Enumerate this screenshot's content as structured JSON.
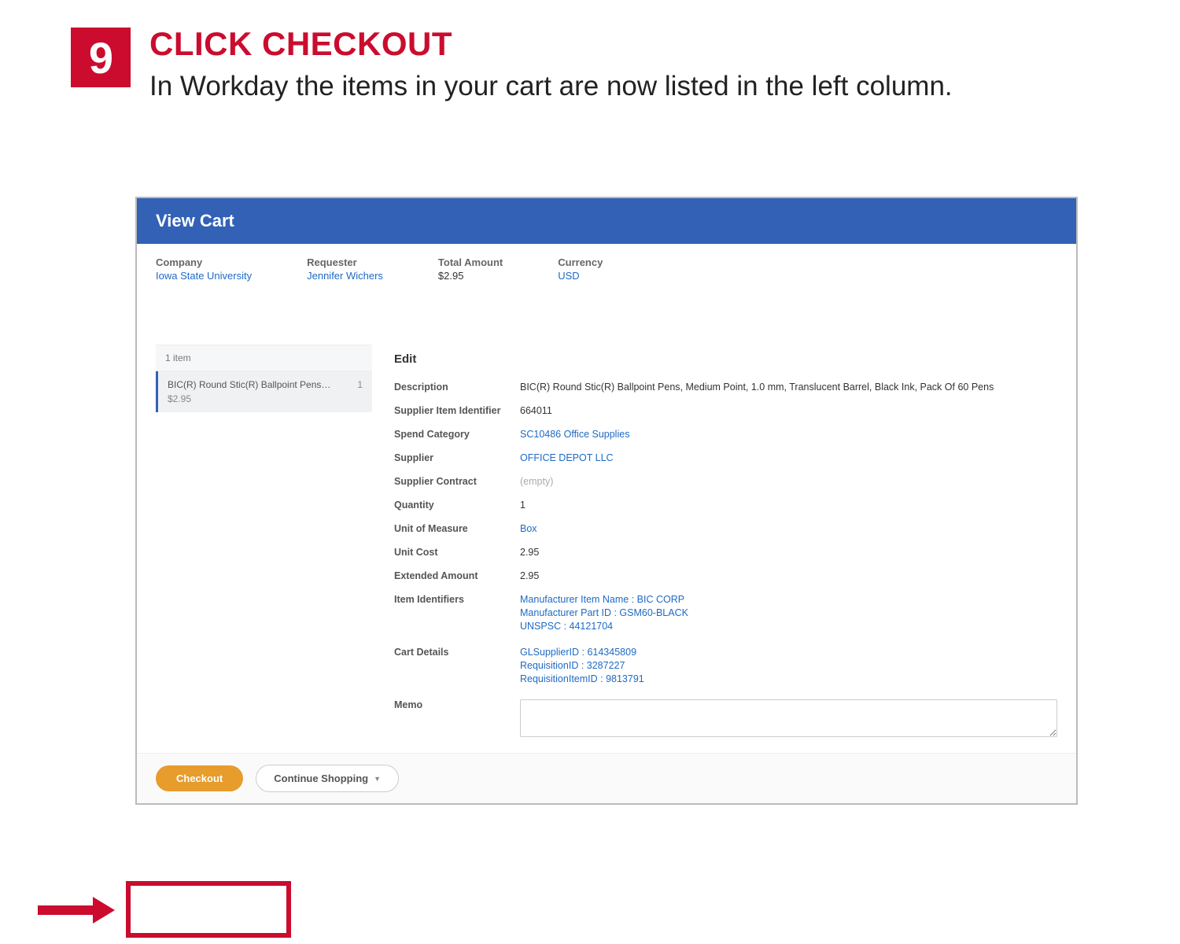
{
  "step": {
    "number": "9",
    "title": "CLICK CHECKOUT",
    "description": "In Workday the items in your cart are now listed in the left column."
  },
  "app": {
    "header_title": "View Cart",
    "meta": {
      "company_label": "Company",
      "company_value": "Iowa State University",
      "requester_label": "Requester",
      "requester_value": "Jennifer Wichers",
      "total_label": "Total Amount",
      "total_value": "$2.95",
      "currency_label": "Currency",
      "currency_value": "USD"
    },
    "left_col": {
      "count_text": "1 item",
      "item_name": "BIC(R) Round Stic(R) Ballpoint Pens…",
      "item_price": "$2.95",
      "item_qty": "1"
    },
    "details": {
      "title": "Edit",
      "fields": {
        "description_label": "Description",
        "description_value": "BIC(R) Round Stic(R) Ballpoint Pens, Medium Point, 1.0 mm, Translucent Barrel, Black Ink, Pack Of 60 Pens",
        "supplier_item_id_label": "Supplier Item Identifier",
        "supplier_item_id_value": "664011",
        "spend_category_label": "Spend Category",
        "spend_category_value": "SC10486 Office Supplies",
        "supplier_label": "Supplier",
        "supplier_value": "OFFICE DEPOT LLC",
        "supplier_contract_label": "Supplier Contract",
        "supplier_contract_value": "(empty)",
        "quantity_label": "Quantity",
        "quantity_value": "1",
        "uom_label": "Unit of Measure",
        "uom_value": "Box",
        "unit_cost_label": "Unit Cost",
        "unit_cost_value": "2.95",
        "extended_amount_label": "Extended Amount",
        "extended_amount_value": "2.95",
        "item_identifiers_label": "Item Identifiers",
        "item_identifiers_1": "Manufacturer Item Name : BIC CORP",
        "item_identifiers_2": "Manufacturer Part ID : GSM60-BLACK",
        "item_identifiers_3": "UNSPSC : 44121704",
        "cart_details_label": "Cart Details",
        "cart_details_1": "GLSupplierID : 614345809",
        "cart_details_2": "RequisitionID : 3287227",
        "cart_details_3": "RequisitionItemID : 9813791",
        "memo_label": "Memo"
      }
    },
    "buttons": {
      "checkout": "Checkout",
      "continue_shopping": "Continue Shopping"
    }
  }
}
